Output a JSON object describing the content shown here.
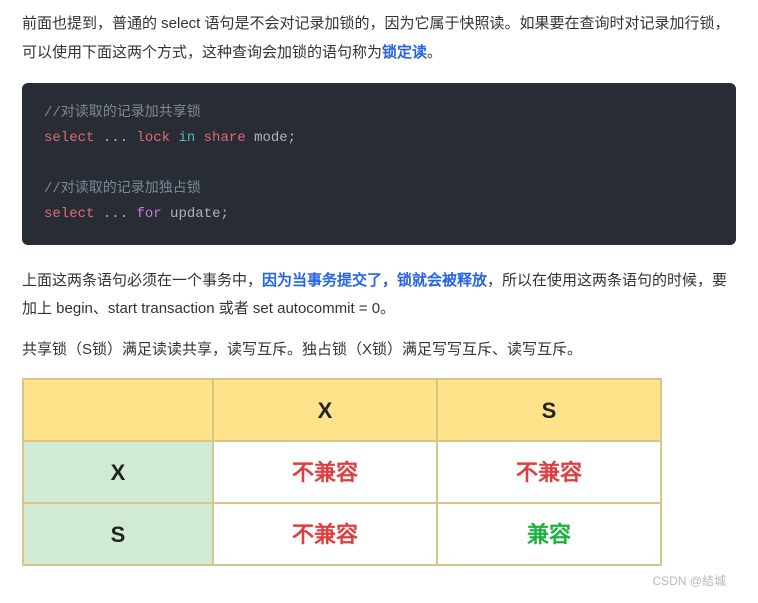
{
  "para1": {
    "seg1": "前面也提到，普通的 select 语句是不会对记录加锁的，因为它属于快照读。如果要在查询时对记录加行锁，可以使用下面这两个方式，这种查询会加锁的语句称为",
    "bold1": "锁定读",
    "seg2": "。"
  },
  "code": {
    "line1": {
      "comment": "//对读取的记录加共享锁"
    },
    "line2": {
      "select": "select",
      "dots": " ... ",
      "lock": "lock",
      "in": " in ",
      "share": "share",
      "mode": " mode;"
    },
    "line3": "",
    "line4": {
      "comment": "//对读取的记录加独占锁"
    },
    "line5": {
      "select": "select",
      "dots": " ... ",
      "for": "for",
      "update": " update;"
    }
  },
  "para2": {
    "seg1": "上面这两条语句必须在一个事务中，",
    "bold1": "因为当事务提交了，锁就会被释放",
    "seg2": "，所以在使用这两条语句的时候，要加上 begin、start transaction 或者 set autocommit = 0。"
  },
  "para3": "共享锁（S锁）满足读读共享，读写互斥。独占锁（X锁）满足写写互斥、读写互斥。",
  "table": {
    "header": {
      "corner": "",
      "c1": "X",
      "c2": "S"
    },
    "row1": {
      "label": "X",
      "c1": "不兼容",
      "c2": "不兼容"
    },
    "row2": {
      "label": "S",
      "c1": "不兼容",
      "c2": "兼容"
    }
  },
  "watermark": "CSDN @結城"
}
